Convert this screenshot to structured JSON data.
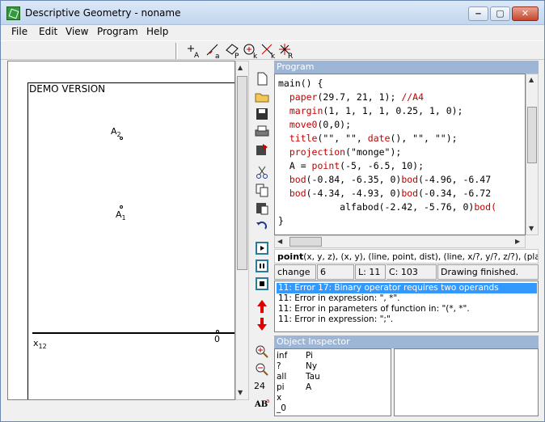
{
  "window": {
    "title": "Descriptive Geometry - noname",
    "buttons": {
      "min": "‒",
      "max": "▢",
      "close": "✕"
    }
  },
  "menu": [
    "File",
    "Edit",
    "View",
    "Program",
    "Help"
  ],
  "toolbar": {
    "tools": [
      {
        "icon": "point-tool-icon",
        "sub": "A"
      },
      {
        "icon": "line-tool-icon",
        "sub": "a"
      },
      {
        "icon": "plane-tool-icon",
        "sub": "P"
      },
      {
        "icon": "circle-tool-icon",
        "sub": "k"
      },
      {
        "icon": "curve-tool-icon",
        "sub": "k"
      },
      {
        "icon": "star-tool-icon",
        "sub": "R"
      }
    ]
  },
  "canvas": {
    "demo": "DEMO VERSION",
    "points": [
      {
        "label": "A",
        "sub": "2"
      },
      {
        "label": "A",
        "sub": "1"
      }
    ],
    "axis_label": "x",
    "axis_sub": "12",
    "origin": "0"
  },
  "panels": {
    "program": "Program",
    "object_inspector": "Object Inspector"
  },
  "code": [
    {
      "parts": [
        {
          "t": "main() {",
          "c": "blk"
        }
      ]
    },
    {
      "parts": [
        {
          "t": "  paper",
          "c": "fn"
        },
        {
          "t": "(29.7, 21, 1); ",
          "c": "blk"
        },
        {
          "t": "//A4",
          "c": "cmt"
        }
      ]
    },
    {
      "parts": [
        {
          "t": "  margin",
          "c": "fn"
        },
        {
          "t": "(1, 1, 1, 1, 0.25, 1, 0);",
          "c": "blk"
        }
      ]
    },
    {
      "parts": [
        {
          "t": "  move0",
          "c": "fn"
        },
        {
          "t": "(0,0);",
          "c": "blk"
        }
      ]
    },
    {
      "parts": [
        {
          "t": "  title",
          "c": "fn"
        },
        {
          "t": "(\"\", \"\", ",
          "c": "blk"
        },
        {
          "t": "date",
          "c": "fn"
        },
        {
          "t": "(), \"\", \"\");",
          "c": "blk"
        }
      ]
    },
    {
      "parts": [
        {
          "t": "  projection",
          "c": "fn"
        },
        {
          "t": "(\"monge\");",
          "c": "blk"
        }
      ]
    },
    {
      "parts": [
        {
          "t": "  A = ",
          "c": "blk"
        },
        {
          "t": "point",
          "c": "fn"
        },
        {
          "t": "(-5, -6.5, 10);",
          "c": "blk"
        }
      ]
    },
    {
      "parts": [
        {
          "t": "  bod",
          "c": "fn"
        },
        {
          "t": "(-0.84, -6.35, 0)",
          "c": "blk"
        },
        {
          "t": "bod",
          "c": "fn"
        },
        {
          "t": "(-4.96, -6.47",
          "c": "blk"
        }
      ]
    },
    {
      "parts": [
        {
          "t": "  bod",
          "c": "fn"
        },
        {
          "t": "(-4.34, -4.93, 0)",
          "c": "blk"
        },
        {
          "t": "bod",
          "c": "fn"
        },
        {
          "t": "(-0.34, -6.72",
          "c": "blk"
        }
      ]
    },
    {
      "parts": [
        {
          "t": "           alfabod",
          "c": "blk"
        },
        {
          "t": "(-2.42, -5.76, 0)",
          "c": "blk"
        },
        {
          "t": "bod(",
          "c": "fn"
        }
      ]
    },
    {
      "parts": [
        {
          "t": "}",
          "c": "blk"
        }
      ]
    }
  ],
  "signature": {
    "name": "point",
    "args": "(x, y, z), (x, y), (line, point, dist), (line, x/?, y/?, z/?), (plane, x/?, y/?"
  },
  "status": {
    "mode": "change",
    "value": "6",
    "line": "L: 11",
    "col": "C: 103",
    "message": "Drawing finished."
  },
  "errors": [
    "11: Error 17: Binary operator requires two operands",
    "11: Error in expression: \", *\".",
    "11: Error in parameters of function in: \"(*, *\".",
    "11: Error in expression: \";\"."
  ],
  "sidebar": {
    "zoom": "24"
  },
  "inspector": [
    {
      "name": "inf",
      "value": "Pi"
    },
    {
      "name": "?",
      "value": "Ny"
    },
    {
      "name": "all",
      "value": "Tau"
    },
    {
      "name": "pi",
      "value": "A"
    },
    {
      "name": "x",
      "value": ""
    },
    {
      "name": "_0",
      "value": ""
    }
  ]
}
